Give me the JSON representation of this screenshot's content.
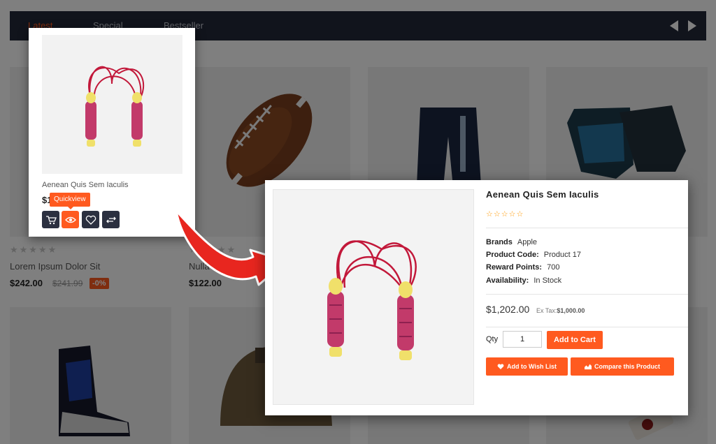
{
  "tabs": {
    "latest": "Latest",
    "special": "Special",
    "bestseller": "Bestseller"
  },
  "background_products": [
    {
      "name": "Lorem Ipsum Dolor Sit",
      "price": "$242.00",
      "old_price": "$241.99",
      "badge": "-0%",
      "stars": "★★★★★"
    },
    {
      "name": "Nulla Eget Elit Ulla",
      "price": "$122.00",
      "stars": "★★★★★"
    }
  ],
  "card": {
    "name": "Aenean Quis Sem Iaculis",
    "price": "$1",
    "tooltip": "Quickview",
    "icons": [
      "cart-icon",
      "eye-icon",
      "heart-icon",
      "compare-icon"
    ]
  },
  "quickview": {
    "title": "Aenean Quis Sem Iaculis",
    "stars": "☆☆☆☆☆",
    "details": {
      "brand_label": "Brands",
      "brand": "Apple",
      "code_label": "Product Code:",
      "code": "Product 17",
      "reward_label": "Reward Points:",
      "reward": "700",
      "avail_label": "Availability:",
      "avail": "In Stock"
    },
    "price": "$1,202.00",
    "ex_tax_label": "Ex Tax:",
    "ex_tax_value": "$1,000.00",
    "qty_label": "Qty",
    "qty_value": "1",
    "add_to_cart": "Add to Cart",
    "wishlist": "Add to Wish List",
    "compare": "Compare this Product"
  },
  "colors": {
    "accent": "#ff5a1f",
    "dark": "#232838",
    "arrow": "#e8261f"
  }
}
